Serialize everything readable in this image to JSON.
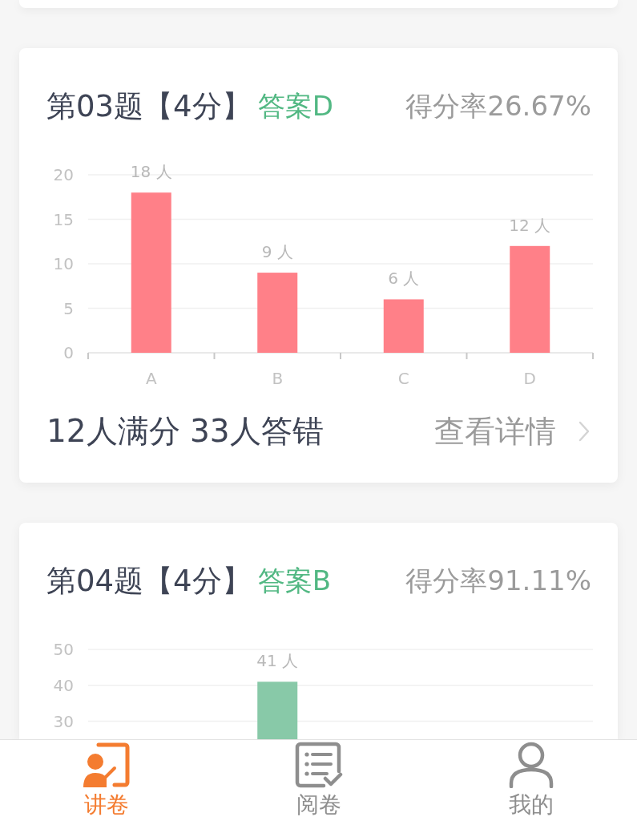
{
  "questions": [
    {
      "title": "第03题【4分】",
      "answer": "答案D",
      "score_rate": "得分率26.67%",
      "chart_data": {
        "type": "bar",
        "categories": [
          "A",
          "B",
          "C",
          "D"
        ],
        "series": [
          {
            "color": "#ff8088",
            "values": [
              18,
              9,
              6,
              12
            ]
          }
        ],
        "value_labels": [
          "18 人",
          "9 人",
          "6 人",
          "12 人"
        ],
        "ylim": [
          0,
          20
        ],
        "yticks": [
          0,
          5,
          10,
          15,
          20
        ],
        "grid": true
      },
      "summary": "12人满分 33人答错",
      "details_link": "查看详情"
    },
    {
      "title": "第04题【4分】",
      "answer": "答案B",
      "score_rate": "得分率91.11%",
      "chart_data": {
        "type": "bar",
        "series": [
          {
            "color": "#88c9a8",
            "values": [
              null,
              41,
              null,
              null
            ]
          }
        ],
        "value_labels": [
          null,
          "41 人",
          null,
          null
        ],
        "ylim": [
          25,
          50
        ],
        "yticks": [
          30,
          40,
          50
        ],
        "grid": true
      }
    }
  ],
  "tab_bar": [
    {
      "label": "讲卷",
      "selected": true
    },
    {
      "label": "阅卷",
      "selected": false
    },
    {
      "label": "我的",
      "selected": false
    }
  ]
}
